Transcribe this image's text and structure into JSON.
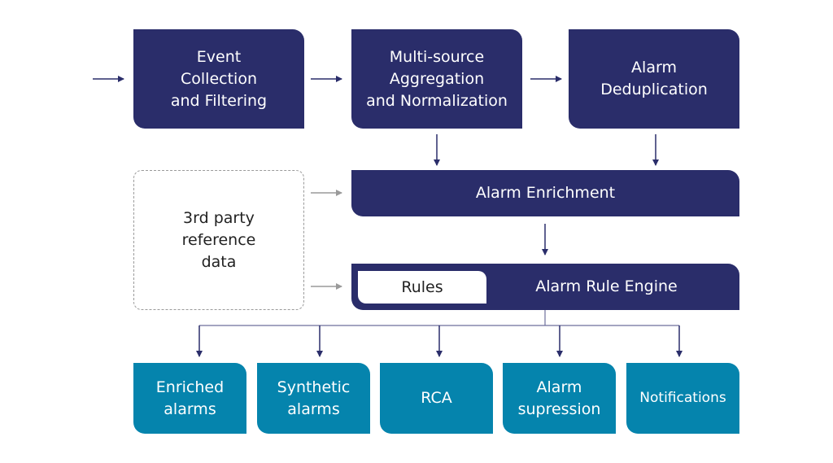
{
  "colors": {
    "primary": "#2a2d6a",
    "output": "#0584ad",
    "reference_arrow": "#9a9a9a"
  },
  "pipeline": [
    {
      "label": "Event\nCollection\nand Filtering"
    },
    {
      "label": "Multi-source\nAggregation\nand Normalization"
    },
    {
      "label": "Alarm\nDeduplication"
    }
  ],
  "reference": {
    "label": "3rd  party\nreference\ndata"
  },
  "enrichment": {
    "label": "Alarm Enrichment"
  },
  "rule_engine": {
    "label": "Alarm Rule Engine",
    "rules_label": "Rules"
  },
  "outputs": [
    {
      "label": "Enriched\nalarms"
    },
    {
      "label": "Synthetic\nalarms"
    },
    {
      "label": "RCA"
    },
    {
      "label": "Alarm\nsupression"
    },
    {
      "label": "Notifications"
    }
  ]
}
